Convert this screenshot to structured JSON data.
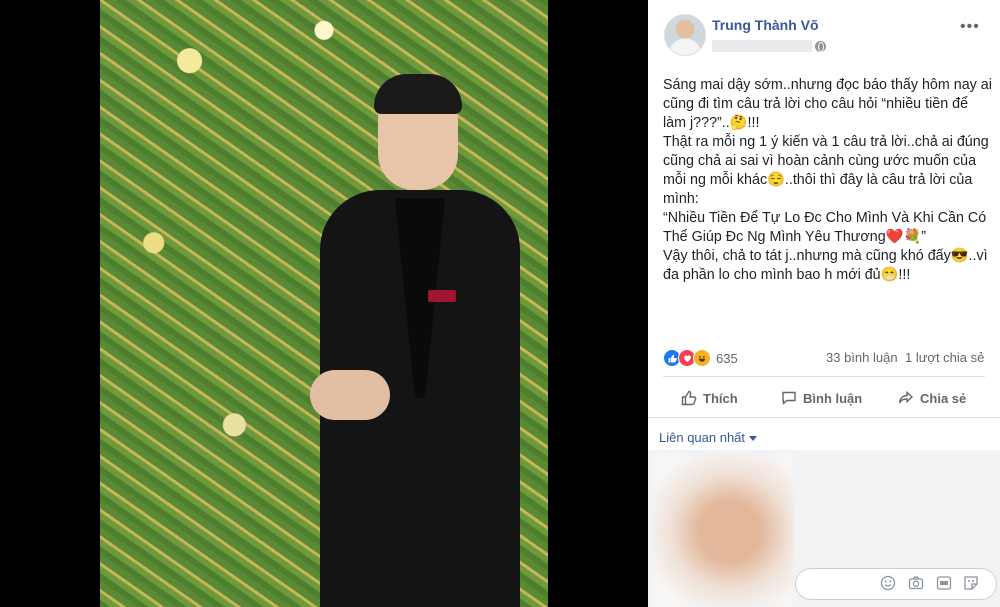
{
  "post": {
    "author": "Trung Thành Võ",
    "text_lines": [
      "Sáng mai dậy sớm..nhưng đọc báo thấy hôm nay ai cũng đi tìm câu trả lời cho câu hỏi “nhiều tiền để làm j???”..🤔!!!",
      "Thật ra mỗi ng 1 ý kiến và 1 câu trả lời..chả ai đúng cũng chả ai sai vì hoàn cảnh cùng ước muốn của mỗi ng mỗi khác😌..thôi thì đây là câu trả lời của mình:",
      "“Nhiều Tiền Để Tự Lo Đc Cho Mình Và Khi Cần Có Thể Giúp Đc Ng Mình Yêu Thương❤️💐”",
      "Vậy thôi, chả to tát j..nhưng mà cũng khó đấy😎..vì đa phần lo cho mình bao h mới đủ😁!!!"
    ]
  },
  "stats": {
    "reaction_count": "635",
    "comments": "33 bình luận",
    "shares": "1 lượt chia sẻ"
  },
  "actions": {
    "like": "Thích",
    "comment": "Bình luận",
    "share": "Chia sẻ"
  },
  "related": {
    "label": "Liên quan nhất"
  },
  "icons": {
    "privacy": "globe-icon",
    "more": "more-options-icon",
    "emoji": "emoji-icon",
    "camera": "camera-icon",
    "gif": "gif-icon",
    "sticker": "sticker-icon"
  },
  "colors": {
    "link_blue": "#385898",
    "like_blue": "#1877f2",
    "love_red": "#f33e58",
    "haha_yellow": "#f7b125"
  }
}
